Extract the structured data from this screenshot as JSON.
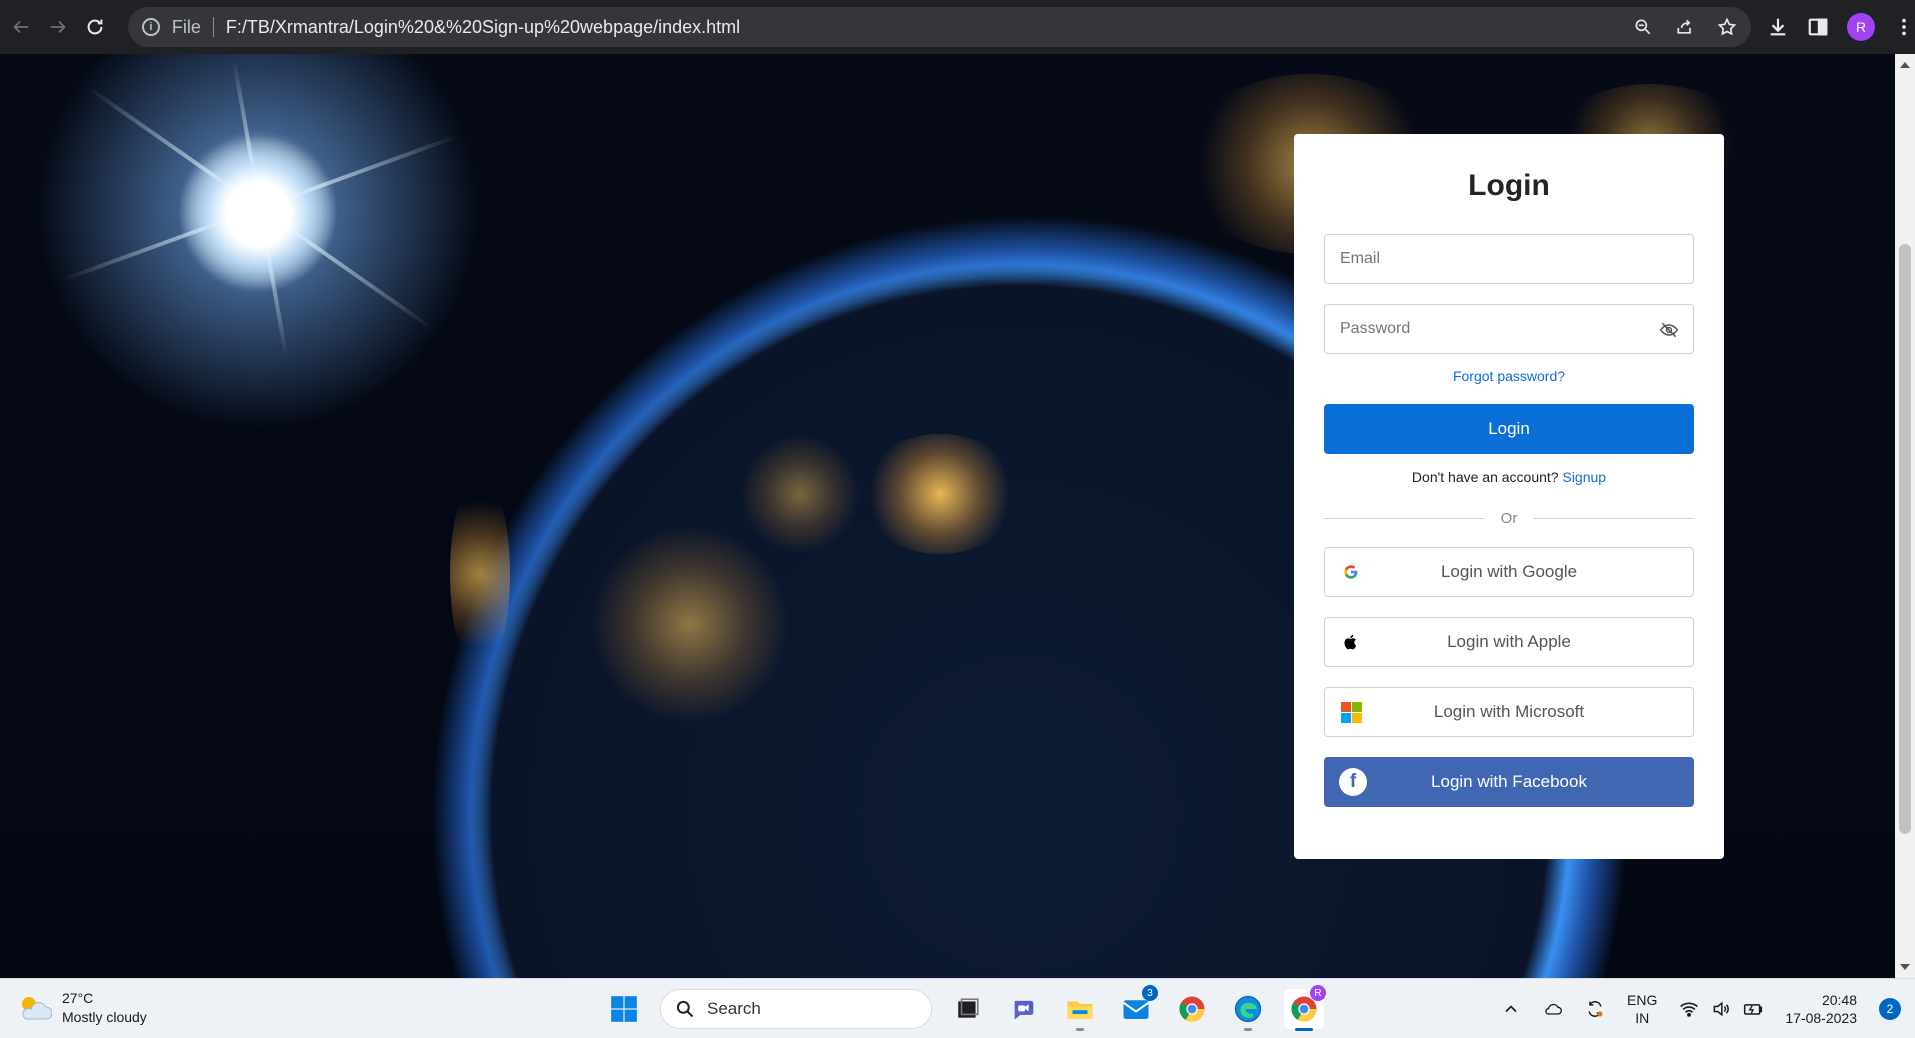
{
  "browser": {
    "scheme_label": "File",
    "url": "F:/TB/Xrmantra/Login%20&%20Sign-up%20webpage/index.html",
    "profile_initial": "R"
  },
  "login": {
    "title": "Login",
    "email_placeholder": "Email",
    "password_placeholder": "Password",
    "forgot_label": "Forgot password?",
    "login_button": "Login",
    "no_account_text": "Don't have an account?",
    "signup_link": "Signup",
    "divider_text": "Or",
    "social": {
      "google": "Login with Google",
      "apple": "Login with Apple",
      "microsoft": "Login with Microsoft",
      "facebook": "Login with Facebook"
    },
    "colors": {
      "primary": "#0a6fd6",
      "facebook": "#4167b2"
    }
  },
  "taskbar": {
    "weather_temp": "27°C",
    "weather_desc": "Mostly cloudy",
    "search_label": "Search",
    "mail_badge": "3",
    "lang_line1": "ENG",
    "lang_line2": "IN",
    "time": "20:48",
    "date": "17-08-2023",
    "notification_count": "2",
    "chrome_profile_badge": "R"
  }
}
